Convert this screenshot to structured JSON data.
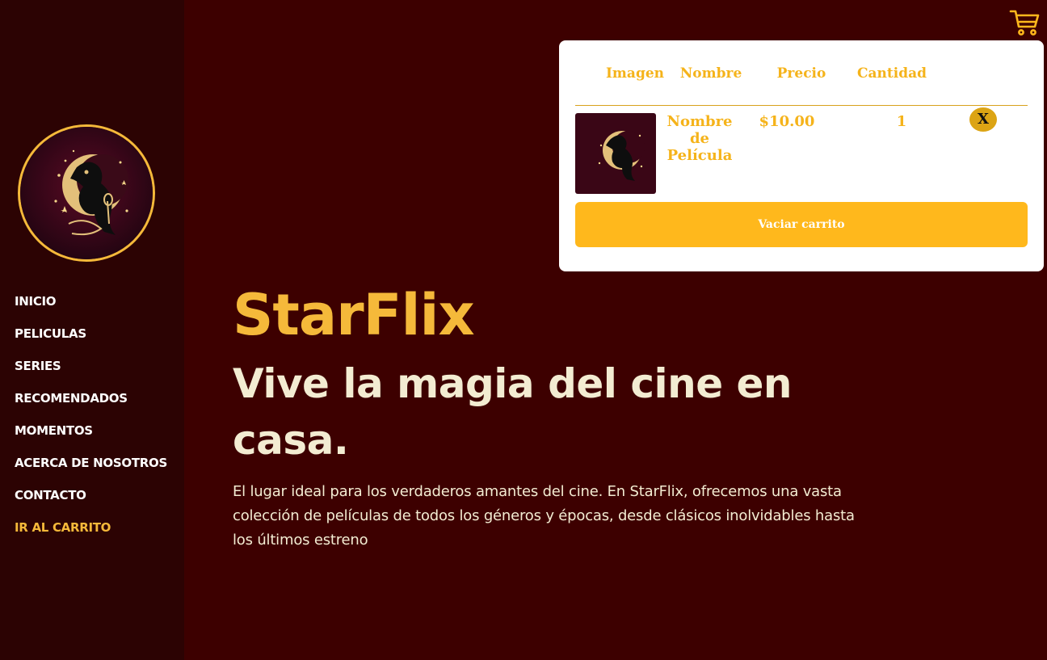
{
  "colors": {
    "background": "#3d0000",
    "sidebar": "#2c0303",
    "accent": "#f5b93a",
    "cart_accent": "#ffb81c",
    "text_light": "#f3ecd2"
  },
  "icons": {
    "cart": "shopping-cart-icon",
    "logo": "raven-moon-logo"
  },
  "nav": {
    "items": [
      {
        "label": "INICIO"
      },
      {
        "label": "PELICULAS"
      },
      {
        "label": "SERIES"
      },
      {
        "label": "RECOMENDADOS"
      },
      {
        "label": "MOMENTOS"
      },
      {
        "label": "ACERCA DE NOSOTROS"
      },
      {
        "label": "CONTACTO"
      },
      {
        "label": "IR AL CARRITO"
      }
    ]
  },
  "hero": {
    "title": "StarFlix",
    "subtitle": "Vive la magia del cine en casa.",
    "description": "El lugar ideal para los verdaderos amantes del cine. En StarFlix, ofrecemos una vasta colección de películas de todos los géneros y épocas, desde clásicos inolvidables hasta los últimos estreno"
  },
  "cart": {
    "headers": [
      "Imagen",
      "Nombre",
      "Precio",
      "Cantidad"
    ],
    "items": [
      {
        "name": "Nombre de Película",
        "price": "$10.00",
        "quantity": "1",
        "remove_label": "X"
      }
    ],
    "empty_label": "Vaciar carrito"
  }
}
